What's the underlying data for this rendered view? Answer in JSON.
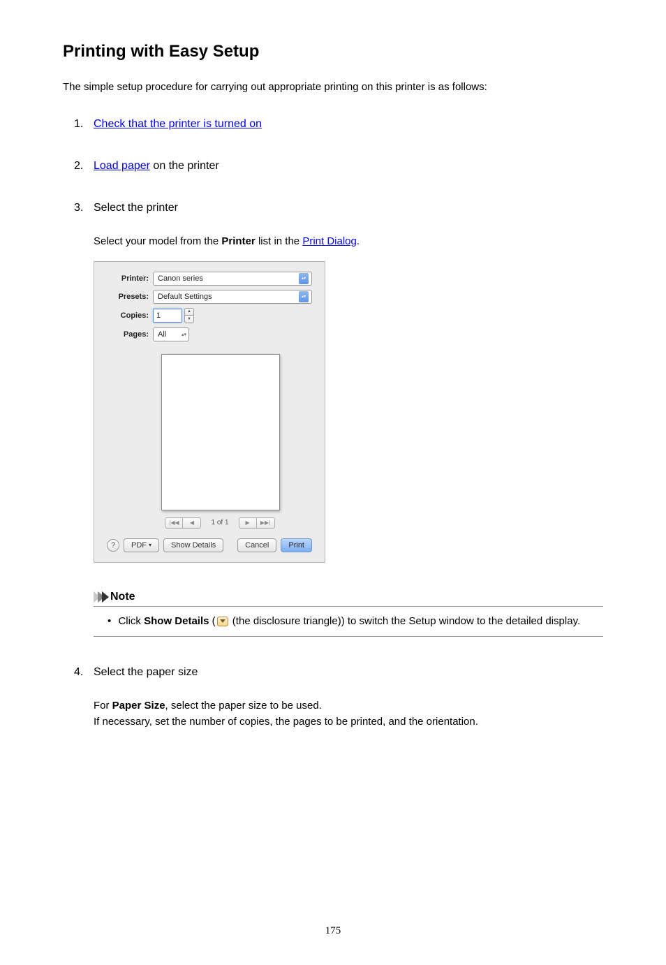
{
  "title": "Printing with Easy Setup",
  "intro": "The simple setup procedure for carrying out appropriate printing on this printer is as follows:",
  "steps": {
    "s1_link": "Check that the printer is turned on",
    "s2_link": "Load paper",
    "s2_suffix": " on the printer",
    "s3_title": "Select the printer",
    "s3_sub_prefix": "Select your model from the ",
    "s3_sub_bold": "Printer",
    "s3_sub_mid": " list in the ",
    "s3_sub_link": "Print Dialog",
    "s3_sub_suffix": ".",
    "s4_title": "Select the paper size",
    "s4_line1_prefix": "For ",
    "s4_line1_bold": "Paper Size",
    "s4_line1_suffix": ", select the paper size to be used.",
    "s4_line2": "If necessary, set the number of copies, the pages to be printed, and the orientation."
  },
  "dialog": {
    "printer_label": "Printer:",
    "printer_value": "Canon           series",
    "presets_label": "Presets:",
    "presets_value": "Default Settings",
    "copies_label": "Copies:",
    "copies_value": "1",
    "pages_label": "Pages:",
    "pages_value": "All",
    "page_indicator": "1 of 1",
    "help": "?",
    "pdf": "PDF",
    "show_details": "Show Details",
    "cancel": "Cancel",
    "print": "Print"
  },
  "note": {
    "title": "Note",
    "body_prefix": "Click ",
    "body_bold": "Show Details",
    "body_paren_open": " (",
    "body_paren_close": " (the disclosure triangle)) to switch the Setup window to the detailed display."
  },
  "page_number": "175"
}
